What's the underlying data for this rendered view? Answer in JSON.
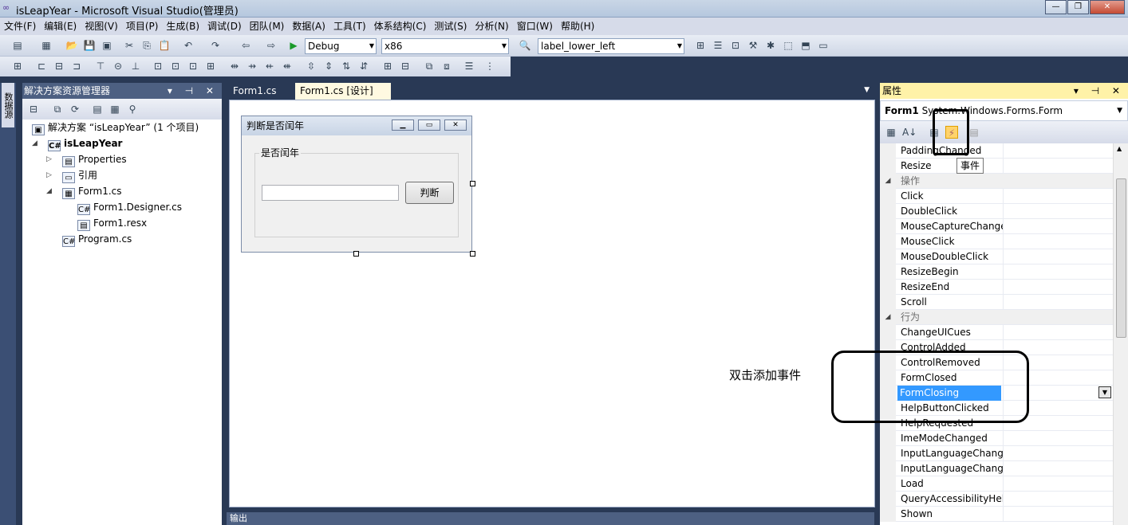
{
  "window": {
    "title": "isLeapYear - Microsoft Visual Studio(管理员)",
    "min": "—",
    "max": "❐",
    "close": "✕"
  },
  "menu": [
    "文件(F)",
    "编辑(E)",
    "视图(V)",
    "项目(P)",
    "生成(B)",
    "调试(D)",
    "团队(M)",
    "数据(A)",
    "工具(T)",
    "体系结构(C)",
    "测试(S)",
    "分析(N)",
    "窗口(W)",
    "帮助(H)"
  ],
  "toolbar": {
    "config": "Debug",
    "platform": "x86",
    "find": "label_lower_left"
  },
  "left_strip": {
    "tab": "数据源"
  },
  "solution_explorer": {
    "title": "解决方案资源管理器",
    "pin": "▾ ⊣ ✕",
    "items": [
      {
        "label": "解决方案 “isLeapYear” (1 个项目)"
      },
      {
        "label": "isLeapYear"
      },
      {
        "label": "Properties"
      },
      {
        "label": "引用"
      },
      {
        "label": "Form1.cs"
      },
      {
        "label": "Form1.Designer.cs"
      },
      {
        "label": "Form1.resx"
      },
      {
        "label": "Program.cs"
      }
    ]
  },
  "tabs": [
    {
      "label": "Form1.cs"
    },
    {
      "label": "Form1.cs [设计]",
      "close": "✕"
    }
  ],
  "form": {
    "title": "判断是否闰年",
    "group_label": "是否闰年",
    "button_label": "判断",
    "textbox_value": ""
  },
  "annotation": "双击添加事件",
  "output": {
    "title": "输出"
  },
  "properties": {
    "title": "属性",
    "object_name": "Form1",
    "object_type": "System.Windows.Forms.Form",
    "tooltip": "事件",
    "rows": [
      {
        "name": "PaddingChanged",
        "type": "prop"
      },
      {
        "name": "Resize",
        "type": "prop"
      },
      {
        "name": "操作",
        "type": "cat"
      },
      {
        "name": "Click",
        "type": "prop"
      },
      {
        "name": "DoubleClick",
        "type": "prop"
      },
      {
        "name": "MouseCaptureChanged",
        "type": "prop"
      },
      {
        "name": "MouseClick",
        "type": "prop"
      },
      {
        "name": "MouseDoubleClick",
        "type": "prop"
      },
      {
        "name": "ResizeBegin",
        "type": "prop"
      },
      {
        "name": "ResizeEnd",
        "type": "prop"
      },
      {
        "name": "Scroll",
        "type": "prop"
      },
      {
        "name": "行为",
        "type": "cat"
      },
      {
        "name": "ChangeUICues",
        "type": "prop"
      },
      {
        "name": "ControlAdded",
        "type": "prop"
      },
      {
        "name": "ControlRemoved",
        "type": "prop"
      },
      {
        "name": "FormClosed",
        "type": "prop"
      },
      {
        "name": "FormClosing",
        "type": "sel"
      },
      {
        "name": "HelpButtonClicked",
        "type": "prop"
      },
      {
        "name": "HelpRequested",
        "type": "prop"
      },
      {
        "name": "ImeModeChanged",
        "type": "prop"
      },
      {
        "name": "InputLanguageChanged",
        "type": "prop"
      },
      {
        "name": "InputLanguageChanging",
        "type": "prop"
      },
      {
        "name": "Load",
        "type": "prop"
      },
      {
        "name": "QueryAccessibilityHelp",
        "type": "prop"
      },
      {
        "name": "Shown",
        "type": "prop"
      }
    ]
  }
}
